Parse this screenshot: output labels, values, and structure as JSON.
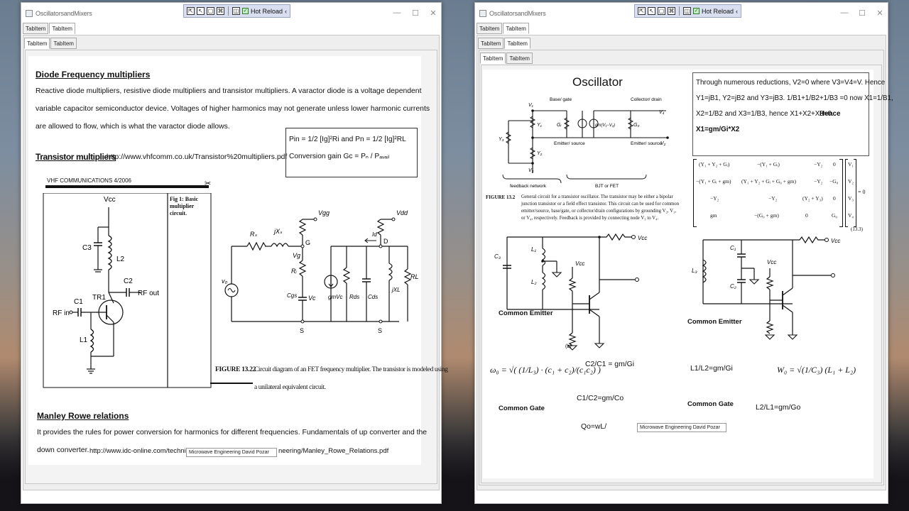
{
  "app": {
    "window_title": "OscillatorsandMixers",
    "hot_reload_label": "Hot Reload",
    "tab_labels": [
      "TabItem",
      "TabItem"
    ]
  },
  "left": {
    "diode_heading": "Diode Frequency multipliers",
    "diode_p1": "Reactive diode multipliers, resistive diode multipliers and transistor multipliers.  A varactor diode is a voltage dependent",
    "diode_p2": "variable capacitor semiconductor device. Voltages of higher harmonics may not generate unless lower harmonic currents",
    "diode_p3": "are allowed to flow, which is what the varactor diode allows.",
    "pin_line": "Pin = 1/2 [Ig]²Ri  and Pn = 1/2 [Ig]²RL",
    "gain_line": "Conversion gain Gc = Pₙ / Pₐᵥₐᵢₗ",
    "transistor_heading": "Transistor multipliers",
    "transistor_url": "http://www.vhfcomm.co.uk/Transistor%20multipliers.pdf",
    "vhf_banner": "VHF COMMUNICATIONS 4/2006",
    "fig1_caption": "Fig 1: Basic multiplier circuit.",
    "fig1_labels": {
      "vcc": "Vcc",
      "c3": "C3",
      "l2": "L2",
      "c2": "C2",
      "tr1": "TR1",
      "rf_out": "RF out",
      "c1": "C1",
      "rf_in": "RF in",
      "l1": "L1"
    },
    "fet_labels": {
      "rs": "Rₛ",
      "jxs": "jXₛ",
      "g": "G",
      "vgg": "Vgg",
      "vg": "Vg",
      "ri": "Rᵢ",
      "cgs": "Cgs",
      "vc": "Vc",
      "s1": "S",
      "v0": "v₀",
      "gmvc": "gmVc",
      "rds": "Rds",
      "cds": "Cds",
      "jxl": "jXL",
      "rl": "RL",
      "id": "Id",
      "d": "D",
      "vdd": "Vdd",
      "s2": "S"
    },
    "fig1322_title": "FIGURE 13.22",
    "fig1322_caption_1": "Circuit diagram of an FET frequency multiplier. The transistor is modeled using",
    "fig1322_caption_2": "a unilateral equivalent circuit.",
    "manley_heading": "Manley Rowe relations",
    "manley_p1": "It provides the rules for power conversion for harmonics for different frequencies. Fundamentals of up converter and the",
    "manley_p2_prefix": "down converter.",
    "manley_url_start": "http://www.idc-online.com/technica",
    "manley_url_end": "neering/Manley_Rowe_Relations.pdf",
    "source_tag": "Microwave Engineering David Pozar"
  },
  "right": {
    "oscillator_title": "Oscillator",
    "reduction_text_1": "Through numerous reductions, V2=0 where V3=V4=V. Hence",
    "reduction_text_2": "Y1=jB1, Y2=jB2 and Y3=jB3.  1/B1+1/B2+1/B3 =0 now X1=1/B1,",
    "reduction_text_3": "X2=1/B2 and X3=1/B3, hence X1+X2+X3=0.",
    "reduction_hence": "Hence",
    "reduction_result": "X1=gm/Gi*X2",
    "fig132_labels": {
      "v1": "V₁",
      "base_gate": "Base/ gate",
      "collector_drain": "Collector/ drain",
      "v4": "V₄",
      "y1": "Y₁",
      "gi": "Gᵢ",
      "gm": "gm(V₁−V₂)",
      "go": "G₀",
      "v2": "V₂",
      "y3": "Y₃",
      "emitter_source_1": "Emitter/ source",
      "emitter_source_2": "Emitter/ source",
      "y2": "Y₂",
      "v3": "V₃",
      "feedback": "feedback network",
      "bjt_fet": "BJT or FET"
    },
    "fig132_title": "FIGURE 13.2",
    "fig132_caption_1": "General circuit for a transistor oscillator. The transistor may be either a bipolar",
    "fig132_caption_2": "junction transistor or a field effect transistor. This circuit can be used for common",
    "fig132_caption_3": "emitter/source, base/gate, or collector/drain configurations by grounding V₂, V₁,",
    "fig132_caption_4": "or V₄, respectively. Feedback is provided by connecting node V₃ to V₄.",
    "matrix_rows": [
      [
        "(Y₁ + Y₂ + Gᵢ)",
        "−(Y₁ + Gᵢ)",
        "−Y₂",
        "0"
      ],
      [
        "−(Y₁ + Gᵢ + gm)",
        "(Y₁ + Y₂ + Gᵢ + G₀ + gm)",
        "−Y₂",
        "−G₀"
      ],
      [
        "−Y₂",
        "−Y₂",
        "(Y₂ + Y₃)",
        "0"
      ],
      [
        "gm",
        "−(G₀ + gm)",
        "0",
        "G₀"
      ]
    ],
    "matrix_vector": [
      "V₁",
      "V₂",
      "V₃",
      "V₄"
    ],
    "matrix_equals": "= 0",
    "matrix_eq_num": "(13.3)",
    "colpitts": {
      "c3": "C₃",
      "l1": "L₁",
      "l2": "L₂",
      "vcc": "Vcc",
      "vcc_top": "Vcc",
      "label": "Common Emitter",
      "sub": "(b)"
    },
    "hartley": {
      "l3": "L₃",
      "c1": "C₁",
      "c2": "C₂",
      "vcc": "Vcc",
      "vcc_top": "Vcc",
      "label": "Common Emitter"
    },
    "omega_formula": "ω₀ = √( (1/L₃) · (c₁ + c₂)/(c₁c₂) )",
    "w0_formula": "W₀ = √(1/C₃) (L₁ + L₂)",
    "c2c1": "C2/C1 = gm/Gi",
    "c1c2": "C1/C2=gm/Co",
    "l1l2": "L1/L2=gm/Gi",
    "l2l1": "L2/L1=gm/Go",
    "common_gate_1": "Common Gate",
    "common_gate_2": "Common Gate",
    "qo": "Qo=wL/",
    "source_tag": "Microwave Engineering David Pozar"
  }
}
